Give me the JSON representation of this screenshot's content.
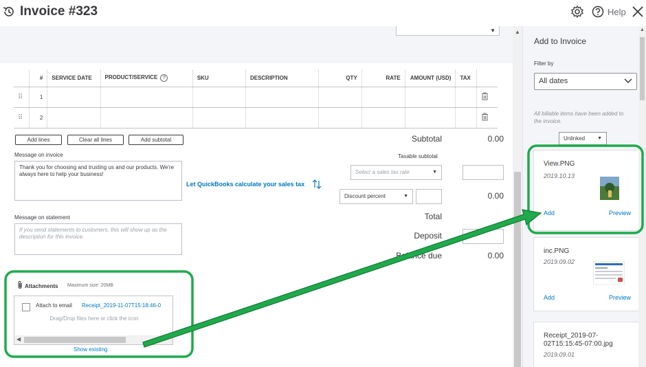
{
  "header": {
    "title": "Invoice #323",
    "help_label": "Help"
  },
  "table": {
    "columns": [
      "",
      "#",
      "SERVICE DATE",
      "PRODUCT/SERVICE",
      "SKU",
      "DESCRIPTION",
      "QTY",
      "RATE",
      "AMOUNT (USD)",
      "TAX",
      ""
    ],
    "rows": [
      {
        "num": "1"
      },
      {
        "num": "2"
      }
    ]
  },
  "buttons": {
    "add_lines": "Add lines",
    "clear_all_lines": "Clear all lines",
    "add_subtotal": "Add subtotal"
  },
  "message_invoice": {
    "label": "Message on invoice",
    "value": "Thank you for choosing and trusting us and our products. We're always here to help your business!"
  },
  "message_statement": {
    "label": "Message on statement",
    "placeholder": "If you send statements to customers, this will show up as the description for this invoice."
  },
  "summary": {
    "subtotal_label": "Subtotal",
    "subtotal_value": "0.00",
    "taxable_subtotal_label": "Taxable subtotal",
    "sales_tax_placeholder": "Select a sales tax rate",
    "quickbooks_link": "Let QuickBooks calculate your sales tax",
    "discount_label": "Discount percent",
    "discount_value": "0.00",
    "total_label": "Total",
    "total_value": "0.00",
    "deposit_label": "Deposit",
    "balance_label": "Balance due",
    "balance_value": "0.00"
  },
  "attachments": {
    "label": "Attachments",
    "max_size": "Maximum size: 20MB",
    "attach_email_label": "Attach to email",
    "file_link": "Receipt_2019-11-07T15:18:46-0",
    "drop_hint": "Drag/Drop files here or click the icon",
    "show_existing": "Show existing"
  },
  "panel": {
    "title": "Add to Invoice",
    "filter_label": "Filter by",
    "filter_value": "All dates",
    "info_text": "All billable items have been added to the invoice.",
    "unlinked_value": "Unlinked",
    "cards": [
      {
        "name": "View.PNG",
        "date": "2019.10.13",
        "add": "Add",
        "preview": "Preview"
      },
      {
        "name": "inc.PNG",
        "date": "2019.09.02",
        "add": "Add",
        "preview": "Preview"
      },
      {
        "name": "Receipt_2019-07-02T15:15:45-07:00.jpg",
        "date": "2019.09.01"
      }
    ]
  },
  "colors": {
    "highlight_green": "#1faa4c",
    "link_blue": "#0077c5"
  }
}
